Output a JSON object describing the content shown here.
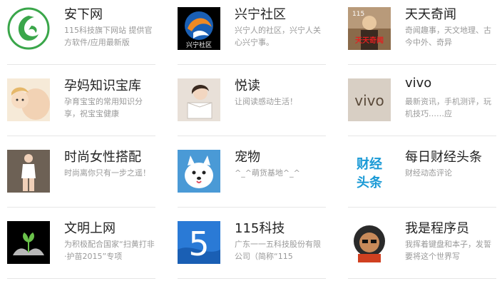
{
  "cards": [
    {
      "title": "安下网",
      "desc": "115科技旗下网站 提供官方软件/应用最新版",
      "thumb": "anxia-logo"
    },
    {
      "title": "兴宁社区",
      "desc": "兴宁人的社区，兴宁人关心兴宁事。",
      "thumb": "xingning-logo"
    },
    {
      "title": "天天奇闻",
      "desc": "奇闻趣事，天文地理、古今中外、奇异",
      "thumb": "tiantian-logo"
    },
    {
      "title": "孕妈知识宝库",
      "desc": "孕育宝宝的常用知识分享，祝宝宝健康",
      "thumb": "baby-photo"
    },
    {
      "title": "悦读",
      "desc": "让阅读感动生活！",
      "thumb": "reading-photo"
    },
    {
      "title": "vivo",
      "desc": "最新资讯，手机测评，玩机技巧……应",
      "thumb": "vivo-logo"
    },
    {
      "title": "时尚女性搭配",
      "desc": "时尚离你只有一步之遥！",
      "thumb": "fashion-photo"
    },
    {
      "title": "宠物",
      "desc": "^_^萌货基地^_^",
      "thumb": "dog-photo"
    },
    {
      "title": "每日财经头条",
      "desc": "财经动态评论",
      "thumb": "finance-logo"
    },
    {
      "title": "文明上网",
      "desc": "为积极配合国家“扫黄打非·护苗2015”专项",
      "thumb": "civil-logo"
    },
    {
      "title": "115科技",
      "desc": "广东一一五科技股份有限公司（简称“115",
      "thumb": "115-logo"
    },
    {
      "title": "我是程序员",
      "desc": "我挥着键盘和本子，发誓要将这个世界写",
      "thumb": "programmer-logo"
    }
  ],
  "thumb_text": {
    "xingning": "兴宁社区",
    "tiantian_num": "115",
    "tiantian": "天天奇闻",
    "vivo": "vivo",
    "finance_top": "财经",
    "finance_bottom": "头条",
    "five": "5"
  },
  "colors": {
    "title": "#222222",
    "desc": "#999999",
    "rule": "#e6e6e6",
    "anxia_green": "#3aa64a",
    "finance_blue": "#1a9ad6"
  }
}
